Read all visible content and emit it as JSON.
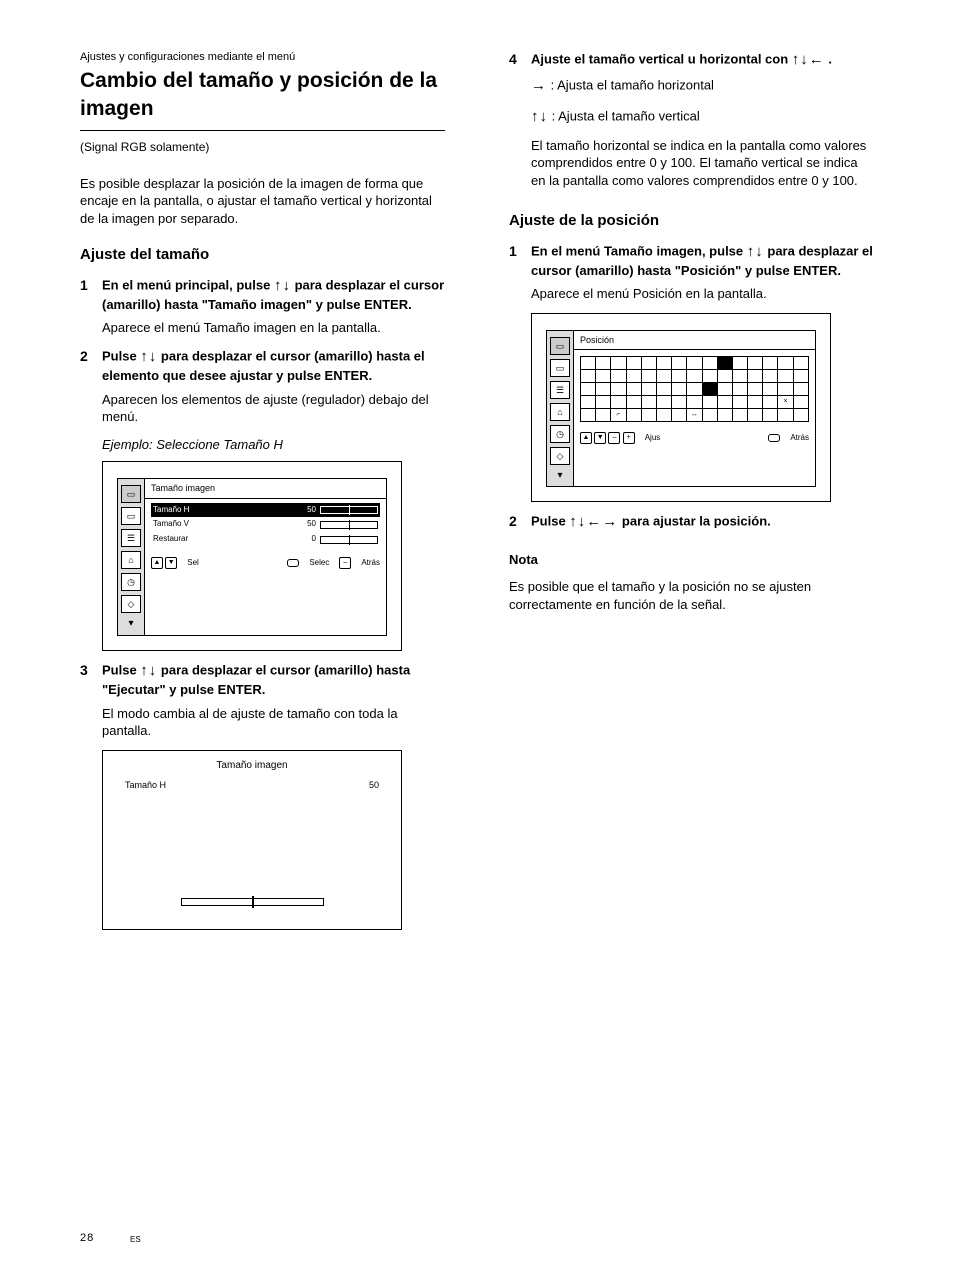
{
  "page_number": "28",
  "lang_code": "ES",
  "left": {
    "region": "Ajustes y configuraciones mediante el menú",
    "title": "Cambio del tamaño y posición de la imagen",
    "subtitle": "(Signal RGB solamente)",
    "intro": "Es posible desplazar la posición de la imagen de forma que encaje en la pantalla, o ajustar el tamaño vertical y horizontal de la imagen por separado.",
    "section_heading": "Ajuste del tamaño",
    "step1a": "En el menú principal, pulse ",
    "step1b": " para desplazar el cursor (amarillo) hasta \"Tamaño imagen\" y pulse ENTER.",
    "menu_appears": "Aparece el menú Tamaño imagen en la pantalla.",
    "step2a": "Pulse ",
    "step2b": " para desplazar el cursor (amarillo) hasta el elemento que desee ajustar y pulse ENTER.",
    "adjust_appears": "Aparecen los elementos de ajuste (regulador) debajo del menú.",
    "example": "Ejemplo: Seleccione Tamaño H",
    "osd1": {
      "title": "Tamaño imagen",
      "rows": [
        {
          "label": "Tamaño H",
          "val": "50"
        },
        {
          "label": "Tamaño V",
          "val": "50"
        },
        {
          "label": "Restaurar",
          "val": "0"
        }
      ],
      "bar_center": 50,
      "footer_a": "Sel",
      "footer_b": "Selec",
      "footer_c": "Atrás"
    },
    "step3a": "Pulse ",
    "step3b": " para desplazar el cursor (amarillo) hasta \"Ejecutar\" y pulse ENTER.",
    "mode_switch": "El modo cambia al de ajuste de tamaño con toda la pantalla.",
    "fullpanel": {
      "title": "Tamaño imagen",
      "item": "Tamaño H",
      "value": "50",
      "bar_center": 50
    }
  },
  "right": {
    "step4a": "Ajuste el tamaño vertical u horizontal con ",
    "step4a2": ".",
    "h_line": ": Ajusta el tamaño horizontal",
    "v_line": ": Ajusta el tamaño vertical",
    "step4b": "El tamaño horizontal se indica en la pantalla como valores comprendidos entre 0 y 100. El tamaño vertical se indica en la pantalla como valores comprendidos entre 0 y 100.",
    "section_heading": "Ajuste de la posición",
    "step1a": "En el menú Tamaño imagen, pulse ",
    "step1b": " para desplazar el cursor (amarillo) hasta \"Posición\" y pulse ENTER.",
    "pos_appears": "Aparece el menú Posición en la pantalla.",
    "osd2": {
      "title": "Posición",
      "grid_marks": true,
      "footer_a": "Ajus",
      "footer_b": "Atrás"
    },
    "step2a": "Pulse ",
    "step2b": " para ajustar la posición.",
    "note_heading": "Nota",
    "note_body": "Es posible que el tamaño y la posición no se ajusten correctamente en función de la señal."
  }
}
